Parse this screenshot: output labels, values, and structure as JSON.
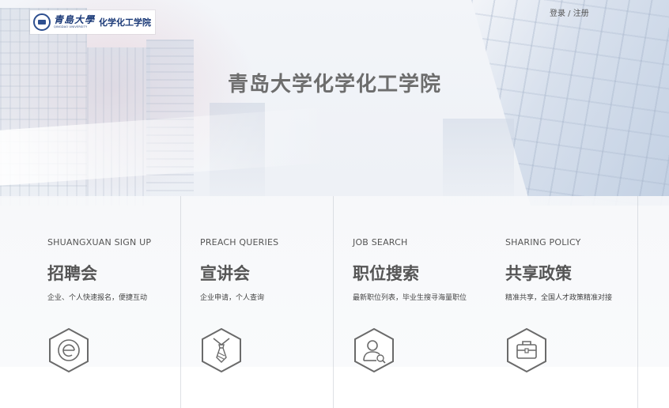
{
  "header": {
    "logo_brand": "青島大學",
    "logo_en": "QINGDAO UNIVERSITY",
    "logo_college": "化学化工学院",
    "auth_login": "登录",
    "auth_sep": " / ",
    "auth_register": "注册"
  },
  "page_title": "青岛大学化学化工学院",
  "cards": [
    {
      "en": "SHUANGXUAN SIGN UP",
      "cn": "招聘会",
      "desc": "企业、个人快速报名，便捷互动",
      "icon": "e-circle-icon"
    },
    {
      "en": "PREACH QUERIES",
      "cn": "宣讲会",
      "desc": "企业申请，个人查询",
      "icon": "necktie-icon"
    },
    {
      "en": "JOB SEARCH",
      "cn": "职位搜索",
      "desc": "最新职位列表，毕业生搜寻海量职位",
      "icon": "user-search-icon"
    },
    {
      "en": "SHARING POLICY",
      "cn": "共享政策",
      "desc": "精准共享，全国人才政策精准对接",
      "icon": "briefcase-icon"
    }
  ],
  "colors": {
    "title_gray": "#6d6d6d",
    "icon_gray": "#666666",
    "logo_blue": "#1b3a78"
  }
}
